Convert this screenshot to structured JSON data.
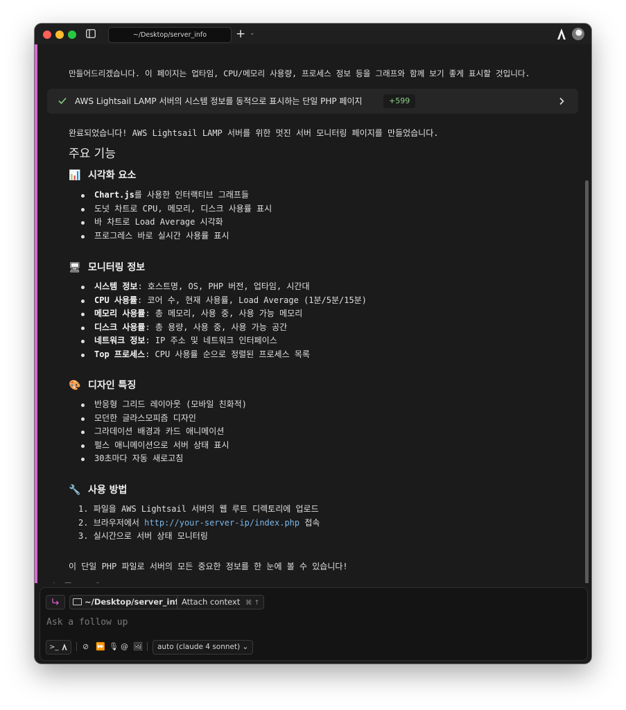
{
  "window": {
    "tab_title": "~/Desktop/server_info",
    "new_tab_label": "+"
  },
  "chat": {
    "intro_cut_line": "만들어드리겠습니다. 이 페이지는 업타임, CPU/메모리 사용량, 프로세스 정보 등을 그래프와 함께 보기 좋게 표시할 것입니다.",
    "task": {
      "label": "AWS Lightsail LAMP 서버의 시스템 정보를 동적으로 표시하는 단일 PHP 페이지",
      "badge": "+599"
    },
    "completion": "완료되었습니다! AWS Lightsail LAMP 서버를 위한 멋진 서버 모니터링 페이지를 만들었습니다.",
    "heading": "주요 기능",
    "sections": [
      {
        "icon": "📊",
        "title": "시각화 요소",
        "items": [
          {
            "bold": "Chart.js",
            "text": "를 사용한 인터랙티브 그래프들"
          },
          {
            "bold": "",
            "text": "도넛 차트로 CPU, 메모리, 디스크 사용률 표시"
          },
          {
            "bold": "",
            "text": "바 차트로 Load Average 시각화"
          },
          {
            "bold": "",
            "text": "프로그레스 바로 실시간 사용률 표시"
          }
        ]
      },
      {
        "icon": "🖥",
        "title": "모니터링 정보",
        "items": [
          {
            "bold": "시스템 정보",
            "text": ": 호스트명, OS, PHP 버전, 업타임, 시간대"
          },
          {
            "bold": "CPU 사용률",
            "text": ": 코어 수, 현재 사용률, Load Average (1분/5분/15분)"
          },
          {
            "bold": "메모리 사용률",
            "text": ": 총 메모리, 사용 중, 사용 가능 메모리"
          },
          {
            "bold": "디스크 사용률",
            "text": ": 총 용량, 사용 중, 사용 가능 공간"
          },
          {
            "bold": "네트워크 정보",
            "text": ": IP 주소 및 네트워크 인터페이스"
          },
          {
            "bold": "Top 프로세스",
            "text": ": CPU 사용률 순으로 정렬된 프로세스 목록"
          }
        ]
      },
      {
        "icon": "🎨",
        "title": "디자인 특징",
        "items": [
          {
            "bold": "",
            "text": "반응형 그리드 레이아웃 (모바일 친화적)"
          },
          {
            "bold": "",
            "text": "모던한 글라스모피즘 디자인"
          },
          {
            "bold": "",
            "text": "그라데이션 배경과 카드 애니메이션"
          },
          {
            "bold": "",
            "text": "펄스 애니메이션으로 서버 상태 표시"
          },
          {
            "bold": "",
            "text": "30초마다 자동 새로고침"
          }
        ]
      }
    ],
    "usage": {
      "icon": "🔧",
      "title": "사용 방법",
      "steps": [
        {
          "num": "1.",
          "text": "파일을 AWS Lightsail 서버의 웹 루트 디렉토리에 업로드",
          "link": "",
          "after": ""
        },
        {
          "num": "2.",
          "text": "브라우저에서 ",
          "link": "http://your-server-ip/index.php",
          "after": " 접속"
        },
        {
          "num": "3.",
          "text": "실시간으로 서버 상태 모니터링",
          "link": "",
          "after": ""
        }
      ]
    },
    "closing": "이 단일 PHP 파일로 서버의 모든 중요한 정보를 한 눈에 볼 수 있습니다!"
  },
  "composer": {
    "path_chip": "~/Desktop/server_info",
    "attach_label": "Attach context",
    "attach_shortcut": "⌘ ↑",
    "placeholder": "Ask a follow up",
    "model": "auto (claude 4 sonnet)"
  },
  "colors": {
    "accent_bar": "#d86bd3",
    "link": "#7ab6e8",
    "badge": "#8fd48a"
  }
}
